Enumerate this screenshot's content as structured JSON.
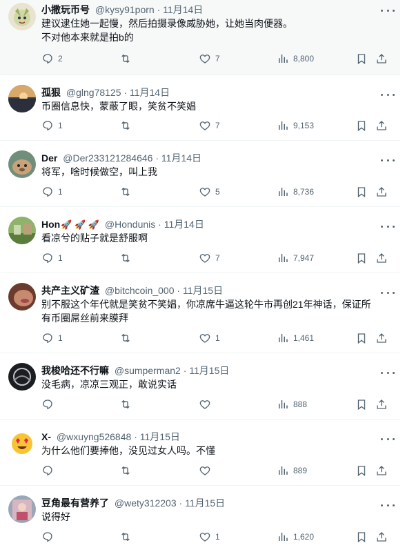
{
  "tweets": [
    {
      "name": "小撒玩币号",
      "handle": "@kysy91porn",
      "dot": "·",
      "time": "11月14日",
      "text": [
        "建议逮住她一起慢，然后拍摄录像威胁她，让她当肉便器。",
        "不对他本来就是拍b的"
      ],
      "replies": "2",
      "retweets": "",
      "likes": "7",
      "views": "8,800"
    },
    {
      "name": "孤狠",
      "handle": "@glng78125",
      "dot": "·",
      "time": "11月14日",
      "text": [
        "币圈信息快，蒙蔽了眼，笑贫不笑娼"
      ],
      "replies": "1",
      "retweets": "",
      "likes": "7",
      "views": "9,153"
    },
    {
      "name": "Der",
      "handle": "@Der233121284646",
      "dot": "·",
      "time": "11月14日",
      "text": [
        "将军，啥时候做空，叫上我"
      ],
      "replies": "1",
      "retweets": "",
      "likes": "5",
      "views": "8,736"
    },
    {
      "name": "Hon",
      "handle": "@Hondunis",
      "dot": "·",
      "time": "11月14日",
      "text": [
        "看凉兮的贴子就是舒服啊"
      ],
      "replies": "1",
      "retweets": "",
      "likes": "7",
      "views": "7,947"
    },
    {
      "name": "共产主义矿渣",
      "handle": "@bitchcoin_000",
      "dot": "·",
      "time": "11月15日",
      "text": [
        "别不服这个年代就是笑贫不笑娼，你凉席牛逼这轮牛市再创21年神话，保证所",
        "有币圈屌丝前来膜拜"
      ],
      "replies": "1",
      "retweets": "",
      "likes": "1",
      "views": "1,461"
    },
    {
      "name": "我梭哈还不行嘛",
      "handle": "@sumperman2",
      "dot": "·",
      "time": "11月15日",
      "text": [
        "没毛病，凉凉三观正，敢说实话"
      ],
      "replies": "",
      "retweets": "",
      "likes": "",
      "views": "888"
    },
    {
      "name": "X-",
      "handle": "@wxuyng526848",
      "dot": "·",
      "time": "11月15日",
      "text": [
        "为什么他们要捧他，没见过女人吗。不懂"
      ],
      "replies": "",
      "retweets": "",
      "likes": "",
      "views": "889"
    },
    {
      "name": "豆角最有营养了",
      "handle": "@wety312203",
      "dot": "·",
      "time": "11月15日",
      "text": [
        "说得好"
      ],
      "replies": "",
      "retweets": "",
      "likes": "1",
      "views": "1,620"
    }
  ],
  "hon_emojis": "🚀 🚀 🚀",
  "icons": {
    "reply": "reply-icon",
    "retweet": "retweet-icon",
    "like": "like-icon",
    "views": "views-icon",
    "bookmark": "bookmark-icon",
    "share": "share-icon",
    "more": "more-icon"
  },
  "colors": {
    "text": "#0f1419",
    "secondary": "#536471",
    "border": "#eff3f4",
    "highlight": "#f7f9f9"
  }
}
